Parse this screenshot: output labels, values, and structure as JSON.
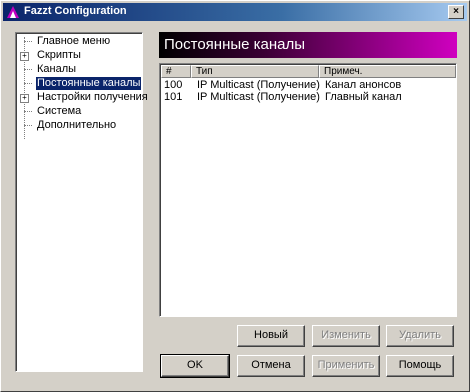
{
  "window": {
    "title": "Fazzt Configuration",
    "close_glyph": "×"
  },
  "tree": {
    "items": [
      {
        "label": "Главное меню",
        "expander": ""
      },
      {
        "label": "Скрипты",
        "expander": "+"
      },
      {
        "label": "Каналы",
        "expander": ""
      },
      {
        "label": "Постоянные каналы",
        "expander": "",
        "selected": true
      },
      {
        "label": "Настройки получения",
        "expander": "+"
      },
      {
        "label": "Система",
        "expander": ""
      },
      {
        "label": "Дополнительно",
        "expander": ""
      }
    ]
  },
  "panel": {
    "title": "Постоянные каналы"
  },
  "list": {
    "columns": [
      "#",
      "Тип",
      "Примеч."
    ],
    "rows": [
      [
        "100",
        "IP Multicast (Получение)",
        "Канал анонсов"
      ],
      [
        "101",
        "IP Multicast (Получение)",
        "Главный канал"
      ]
    ]
  },
  "buttons": {
    "new": "Новый",
    "edit": "Изменить",
    "delete": "Удалить",
    "ok": "OK",
    "cancel": "Отмена",
    "apply": "Применить",
    "help": "Помощь"
  }
}
